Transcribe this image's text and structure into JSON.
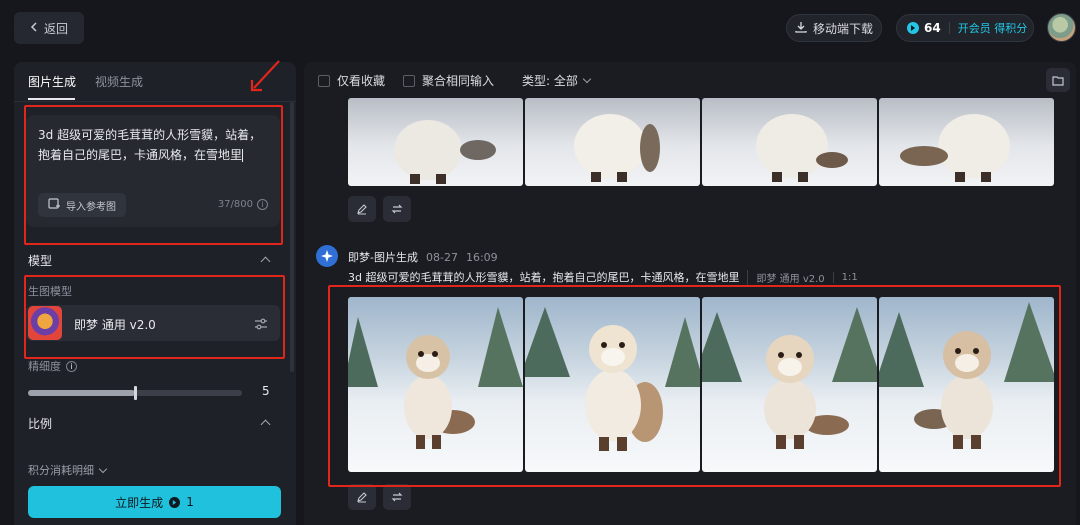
{
  "header": {
    "back_label": "返回",
    "download_label": "移动端下载",
    "credits_value": "64",
    "membership_link": "开会员 得积分"
  },
  "left": {
    "tabs": [
      "图片生成",
      "视频生成"
    ],
    "prompt": {
      "text": "3d 超级可爱的毛茸茸的人形雪貘，站着，抱着自己的尾巴，卡通风格，在雪地里",
      "ref_button": "导入参考图",
      "char_count": "37/800"
    },
    "model_section": {
      "title": "模型",
      "sub_label": "生图模型",
      "model_name": "即梦 通用 v2.0"
    },
    "detail": {
      "label": "精细度",
      "value": "5",
      "fraction": 0.5
    },
    "ratio_title": "比例",
    "cost_label": "积分消耗明细",
    "generate_button": "立即生成",
    "generate_cost": "1"
  },
  "right": {
    "filters": {
      "fav_only": "仅看收藏",
      "merge_inputs": "聚合相同输入",
      "type_label": "类型: 全部"
    },
    "generation": {
      "title": "即梦-图片生成",
      "date": "08-27",
      "time": "16:09",
      "prompt": "3d 超级可爱的毛茸茸的人形雪貘，站着，抱着自己的尾巴，卡通风格，在雪地里",
      "model_tag": "即梦 通用 v2.0",
      "ratio_tag": "1:1"
    }
  },
  "colors": {
    "accent": "#1fc1dd",
    "highlight_red": "#e1261c",
    "background": "#15171c"
  }
}
